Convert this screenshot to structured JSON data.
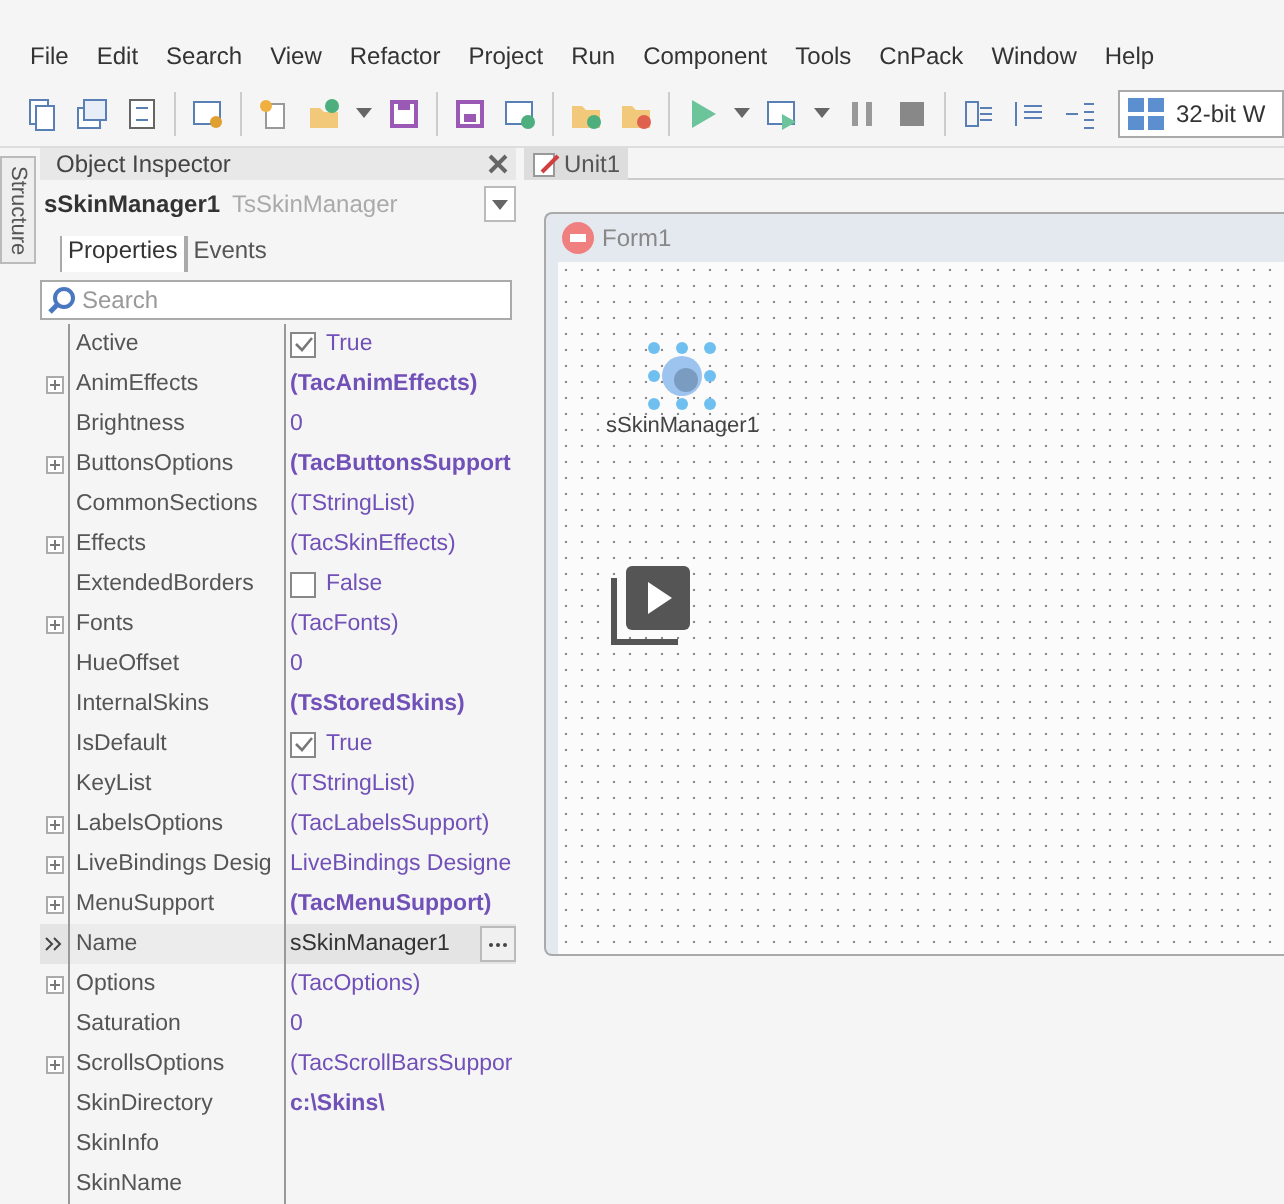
{
  "menu": [
    "File",
    "Edit",
    "Search",
    "View",
    "Refactor",
    "Project",
    "Run",
    "Component",
    "Tools",
    "CnPack",
    "Window",
    "Help"
  ],
  "toolbar": {
    "platform": "32-bit W"
  },
  "structure_tab": {
    "label": "Structure"
  },
  "inspector": {
    "title": "Object Inspector",
    "component_name": "sSkinManager1",
    "component_type": "TsSkinManager",
    "tabs": [
      {
        "label": "Properties",
        "selected": true
      },
      {
        "label": "Events",
        "selected": false
      }
    ],
    "search": {
      "placeholder": "Search"
    },
    "rows": [
      {
        "name": "Active",
        "kind": "check",
        "value": "True",
        "checked": true,
        "bold": false,
        "expandable": false,
        "selected": false
      },
      {
        "name": "AnimEffects",
        "kind": "text",
        "value": "(TacAnimEffects)",
        "bold": true,
        "expandable": true,
        "selected": false
      },
      {
        "name": "Brightness",
        "kind": "text",
        "value": "0",
        "bold": false,
        "expandable": false,
        "selected": false
      },
      {
        "name": "ButtonsOptions",
        "kind": "text",
        "value": "(TacButtonsSupport",
        "bold": true,
        "expandable": true,
        "selected": false
      },
      {
        "name": "CommonSections",
        "kind": "text",
        "value": "(TStringList)",
        "bold": false,
        "expandable": false,
        "selected": false
      },
      {
        "name": "Effects",
        "kind": "text",
        "value": "(TacSkinEffects)",
        "bold": false,
        "expandable": true,
        "selected": false
      },
      {
        "name": "ExtendedBorders",
        "kind": "check",
        "value": "False",
        "checked": false,
        "bold": false,
        "expandable": false,
        "selected": false
      },
      {
        "name": "Fonts",
        "kind": "text",
        "value": "(TacFonts)",
        "bold": false,
        "expandable": true,
        "selected": false
      },
      {
        "name": "HueOffset",
        "kind": "text",
        "value": "0",
        "bold": false,
        "expandable": false,
        "selected": false
      },
      {
        "name": "InternalSkins",
        "kind": "text",
        "value": "(TsStoredSkins)",
        "bold": true,
        "expandable": false,
        "selected": false
      },
      {
        "name": "IsDefault",
        "kind": "check",
        "value": "True",
        "checked": true,
        "bold": false,
        "expandable": false,
        "selected": false
      },
      {
        "name": "KeyList",
        "kind": "text",
        "value": "(TStringList)",
        "bold": false,
        "expandable": false,
        "selected": false
      },
      {
        "name": "LabelsOptions",
        "kind": "text",
        "value": "(TacLabelsSupport)",
        "bold": false,
        "expandable": true,
        "selected": false
      },
      {
        "name": "LiveBindings Desig",
        "kind": "text",
        "value": "LiveBindings Designe",
        "bold": false,
        "expandable": true,
        "selected": false
      },
      {
        "name": "MenuSupport",
        "kind": "text",
        "value": "(TacMenuSupport)",
        "bold": true,
        "expandable": true,
        "selected": false
      },
      {
        "name": "Name",
        "kind": "edit",
        "value": "sSkinManager1",
        "bold": false,
        "selected": true
      },
      {
        "name": "Options",
        "kind": "text",
        "value": "(TacOptions)",
        "bold": false,
        "expandable": true,
        "selected": false
      },
      {
        "name": "Saturation",
        "kind": "text",
        "value": "0",
        "bold": false,
        "expandable": false,
        "selected": false
      },
      {
        "name": "ScrollsOptions",
        "kind": "text",
        "value": "(TacScrollBarsSuppor",
        "bold": false,
        "expandable": true,
        "selected": false
      },
      {
        "name": "SkinDirectory",
        "kind": "text",
        "value": "c:\\Skins\\",
        "bold": true,
        "expandable": false,
        "selected": false
      },
      {
        "name": "SkinInfo",
        "kind": "empty",
        "expandable": false,
        "selected": false
      },
      {
        "name": "SkinName",
        "kind": "empty",
        "expandable": false,
        "selected": false
      }
    ]
  },
  "editor": {
    "tab": "Unit1",
    "form": {
      "title": "Form1",
      "component_label": "sSkinManager1"
    }
  }
}
